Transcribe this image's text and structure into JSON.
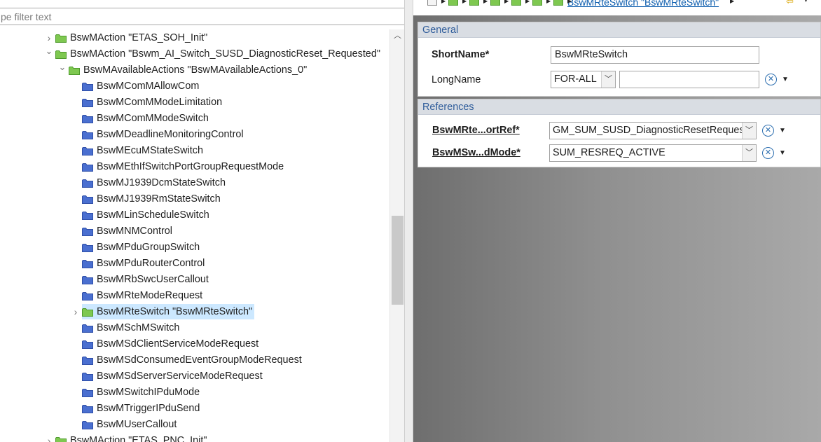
{
  "filter": {
    "placeholder": "pe filter text"
  },
  "tree": {
    "rows": [
      {
        "label": "BswMAction \"ETAS_SOH_Init\"",
        "type": "green",
        "twisty": "collapsed"
      },
      {
        "label": "BswMAction \"Bswm_AI_Switch_SUSD_DiagnosticReset_Requested\"",
        "type": "green",
        "twisty": "expanded"
      },
      {
        "label": "BswMAvailableActions \"BswMAvailableActions_0\"",
        "type": "green",
        "twisty": "expanded"
      },
      {
        "label": "BswMComMAllowCom",
        "type": "blue",
        "twisty": "none"
      },
      {
        "label": "BswMComMModeLimitation",
        "type": "blue",
        "twisty": "none"
      },
      {
        "label": "BswMComMModeSwitch",
        "type": "blue",
        "twisty": "none"
      },
      {
        "label": "BswMDeadlineMonitoringControl",
        "type": "blue",
        "twisty": "none"
      },
      {
        "label": "BswMEcuMStateSwitch",
        "type": "blue",
        "twisty": "none"
      },
      {
        "label": "BswMEthIfSwitchPortGroupRequestMode",
        "type": "blue",
        "twisty": "none"
      },
      {
        "label": "BswMJ1939DcmStateSwitch",
        "type": "blue",
        "twisty": "none"
      },
      {
        "label": "BswMJ1939RmStateSwitch",
        "type": "blue",
        "twisty": "none"
      },
      {
        "label": "BswMLinScheduleSwitch",
        "type": "blue",
        "twisty": "none"
      },
      {
        "label": "BswMNMControl",
        "type": "blue",
        "twisty": "none"
      },
      {
        "label": "BswMPduGroupSwitch",
        "type": "blue",
        "twisty": "none"
      },
      {
        "label": "BswMPduRouterControl",
        "type": "blue",
        "twisty": "none"
      },
      {
        "label": "BswMRbSwcUserCallout",
        "type": "blue",
        "twisty": "none"
      },
      {
        "label": "BswMRteModeRequest",
        "type": "blue",
        "twisty": "none"
      },
      {
        "label": "BswMRteSwitch \"BswMRteSwitch\"",
        "type": "green",
        "twisty": "collapsed",
        "selected": true
      },
      {
        "label": "BswMSchMSwitch",
        "type": "blue",
        "twisty": "none"
      },
      {
        "label": "BswMSdClientServiceModeRequest",
        "type": "blue",
        "twisty": "none"
      },
      {
        "label": "BswMSdConsumedEventGroupModeRequest",
        "type": "blue",
        "twisty": "none"
      },
      {
        "label": "BswMSdServerServiceModeRequest",
        "type": "blue",
        "twisty": "none"
      },
      {
        "label": "BswMSwitchIPduMode",
        "type": "blue",
        "twisty": "none"
      },
      {
        "label": "BswMTriggerIPduSend",
        "type": "blue",
        "twisty": "none"
      },
      {
        "label": "BswMUserCallout",
        "type": "blue",
        "twisty": "none"
      },
      {
        "label": "BswMAction \"ETAS_PNC_Init\"",
        "type": "green",
        "twisty": "collapsed"
      }
    ]
  },
  "breadcrumb": {
    "current": "BswMRteSwitch \"BswMRteSwitch\""
  },
  "general": {
    "title": "General",
    "short_name_label": "ShortName*",
    "short_name_value": "BswMRteSwitch",
    "long_name_label": "LongName",
    "long_name_lang": "FOR-ALL",
    "long_name_value": ""
  },
  "references": {
    "title": "References",
    "rows": [
      {
        "label": "BswMRte...ortRef*",
        "value": "GM_SUM_SUSD_DiagnosticResetReques"
      },
      {
        "label": "BswMSw...dMode*",
        "value": "SUM_RESREQ_ACTIVE"
      }
    ]
  },
  "colors": {
    "selection": "#cce8ff",
    "section_header_text": "#2d5b9a",
    "link": "#0b5cad",
    "folder_green": "#7ec850",
    "folder_blue": "#4a6fd0"
  }
}
